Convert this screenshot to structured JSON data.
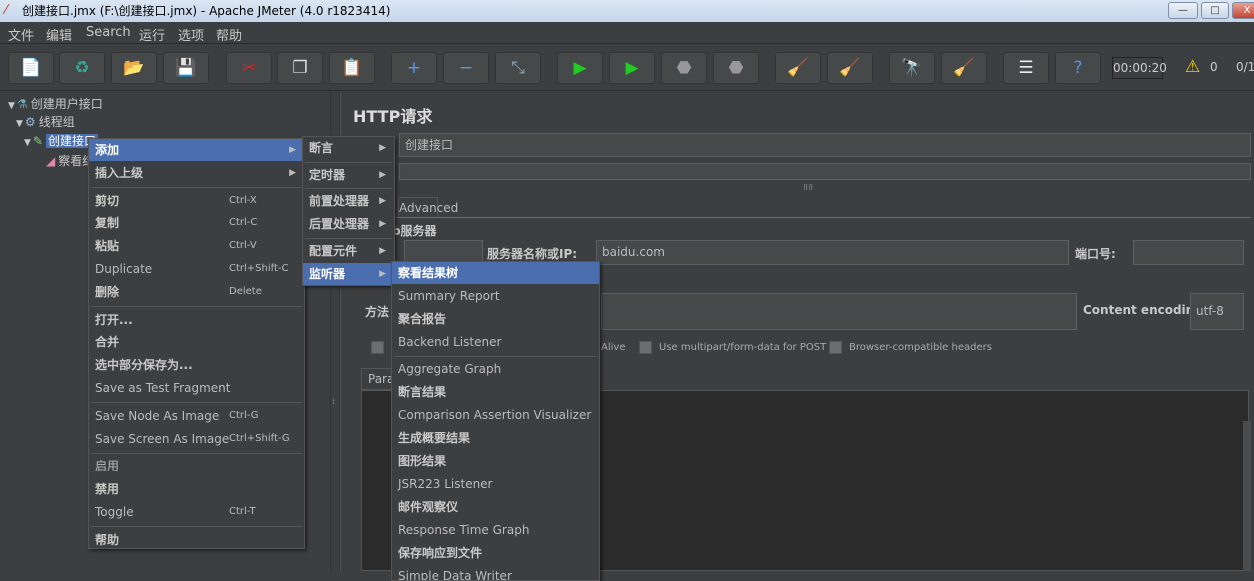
{
  "window": {
    "title": "创建接口.jmx (F:\\创建接口.jmx) - Apache JMeter (4.0 r1823414)",
    "minimize": "—",
    "maximize": "□",
    "close": "X"
  },
  "menubar": [
    "文件",
    "编辑",
    "Search",
    "运行",
    "选项",
    "帮助"
  ],
  "toolbar": {
    "icons": [
      "new-icon",
      "templates-icon",
      "open-icon",
      "save-icon",
      "cut-icon",
      "copy-icon",
      "paste-icon",
      "expand-icon",
      "collapse-icon",
      "toggle-icon",
      "start-icon",
      "start-no-pause-icon",
      "stop-icon",
      "shutdown-icon",
      "clear-icon",
      "clear-all-icon",
      "search-icon",
      "reset-search-icon",
      "function-helper-icon",
      "help-icon"
    ],
    "glyphs": [
      "📄",
      "♻",
      "📂",
      "💾",
      "✂",
      "❐",
      "📋",
      "+",
      "−",
      "⤡",
      "▶",
      "▶",
      "⬣",
      "⬣",
      "🧹",
      "🧹",
      "🔭",
      "🧹",
      "☰",
      "?"
    ],
    "timer": "00:00:20",
    "warnings": "0",
    "threads": "0/1"
  },
  "tree": [
    {
      "label": "创建用户接口",
      "icon": "test-plan-icon"
    },
    {
      "label": "线程组",
      "icon": "gear-icon"
    },
    {
      "label": "创建接口",
      "icon": "pipette-icon",
      "selected": true
    },
    {
      "label": "察看结果树",
      "icon": "listener-icon"
    }
  ],
  "right": {
    "title": "HTTP请求",
    "name_value": "创建接口",
    "tab_advanced": "Advanced",
    "group_title": "Web服务器",
    "server_label": "服务器名称或IP:",
    "server_value": "baidu.com",
    "port_label": "端口号:",
    "method_label": "方法",
    "encoding_label": "Content encoding:",
    "encoding_value": "utf-8",
    "keepalive_partial": "Alive",
    "multipart": "Use multipart/form-data for POST",
    "browser_headers": "Browser-compatible headers",
    "params_tab": "Para"
  },
  "context_menu": [
    {
      "label": "添加",
      "arrow": true,
      "hl": true
    },
    {
      "label": "插入上级",
      "arrow": true
    },
    {
      "sep": true
    },
    {
      "label": "剪切",
      "sc": "Ctrl-X"
    },
    {
      "label": "复制",
      "sc": "Ctrl-C"
    },
    {
      "label": "粘贴",
      "sc": "Ctrl-V"
    },
    {
      "label": "Duplicate",
      "sc": "Ctrl+Shift-C",
      "dim": true
    },
    {
      "label": "删除",
      "sc": "Delete"
    },
    {
      "sep": true
    },
    {
      "label": "打开..."
    },
    {
      "label": "合并"
    },
    {
      "label": "选中部分保存为..."
    },
    {
      "label": "Save as Test Fragment",
      "dim": true
    },
    {
      "sep": true
    },
    {
      "label": "Save Node As Image",
      "sc": "Ctrl-G",
      "dim": true
    },
    {
      "label": "Save Screen As Image",
      "sc": "Ctrl+Shift-G",
      "dim": true
    },
    {
      "sep": true
    },
    {
      "label": "启用",
      "dim": true
    },
    {
      "label": "禁用"
    },
    {
      "label": "Toggle",
      "sc": "Ctrl-T",
      "dim": true
    },
    {
      "sep": true
    },
    {
      "label": "帮助"
    }
  ],
  "add_menu": [
    {
      "label": "断言",
      "arrow": true
    },
    {
      "sep": true
    },
    {
      "label": "定时器",
      "arrow": true
    },
    {
      "sep": true
    },
    {
      "label": "前置处理器",
      "arrow": true
    },
    {
      "label": "后置处理器",
      "arrow": true
    },
    {
      "sep": true
    },
    {
      "label": "配置元件",
      "arrow": true
    },
    {
      "label": "监听器",
      "arrow": true,
      "hl": true
    }
  ],
  "listener_menu": [
    {
      "label": "察看结果树",
      "hl": true
    },
    {
      "label": "Summary Report",
      "dim": true
    },
    {
      "label": "聚合报告"
    },
    {
      "label": "Backend Listener",
      "dim": true
    },
    {
      "sep": true
    },
    {
      "label": "Aggregate Graph",
      "dim": true
    },
    {
      "label": "断言结果"
    },
    {
      "label": "Comparison Assertion Visualizer",
      "dim": true
    },
    {
      "label": "生成概要结果"
    },
    {
      "label": "图形结果"
    },
    {
      "label": "JSR223 Listener",
      "dim": true
    },
    {
      "label": "邮件观察仪"
    },
    {
      "label": "Response Time Graph",
      "dim": true
    },
    {
      "label": "保存响应到文件"
    },
    {
      "label": "Simple Data Writer",
      "dim": true
    }
  ],
  "colors": {
    "highlight": "#4b6eaf",
    "background": "#3c3f41"
  }
}
